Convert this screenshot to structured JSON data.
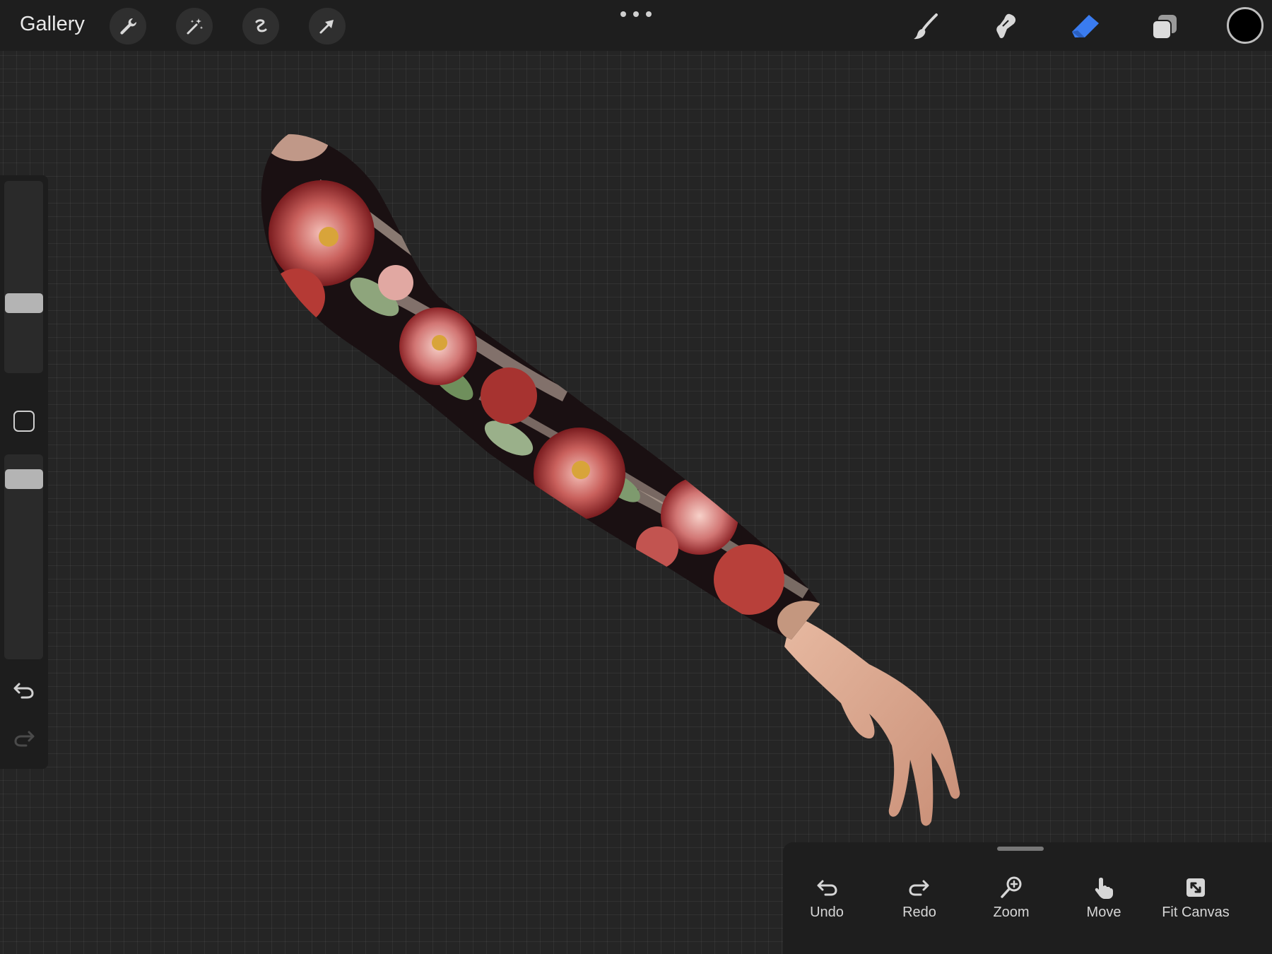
{
  "app": {
    "gallery_label": "Gallery"
  },
  "toolbar": {
    "left_tools": [
      "wrench-icon",
      "magic-wand-icon",
      "selection-icon",
      "transform-arrow-icon"
    ],
    "right_tools": [
      "brush-icon",
      "smudge-icon",
      "eraser-icon",
      "layers-icon"
    ],
    "active_tool": "eraser",
    "active_color": "#3a7cf0",
    "current_color": "#000000"
  },
  "sidebar": {
    "brush_size_level": 0.35,
    "opacity_level": 0.92
  },
  "quick_actions": {
    "undo": "Undo",
    "redo": "Redo",
    "zoom": "Zoom",
    "move": "Move",
    "fit_canvas": "Fit Canvas"
  }
}
